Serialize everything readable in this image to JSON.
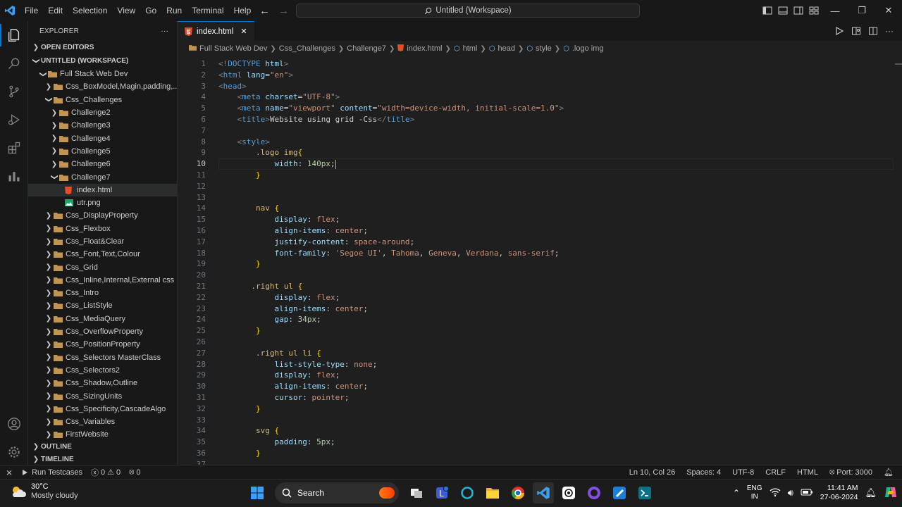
{
  "menu": [
    "File",
    "Edit",
    "Selection",
    "View",
    "Go",
    "Run",
    "Terminal",
    "Help"
  ],
  "command_center": "Untitled (Workspace)",
  "sidebar": {
    "title": "EXPLORER",
    "more": "···",
    "open_editors": "OPEN EDITORS",
    "workspace": "UNTITLED (WORKSPACE)",
    "root": "Full Stack Web Dev",
    "items": [
      {
        "label": "Css_BoxModel,Magin,padding,...",
        "depth": 1,
        "open": false,
        "type": "folder"
      },
      {
        "label": "Css_Challenges",
        "depth": 1,
        "open": true,
        "type": "folder"
      },
      {
        "label": "Challenge2",
        "depth": 2,
        "open": false,
        "type": "folder"
      },
      {
        "label": "Challenge3",
        "depth": 2,
        "open": false,
        "type": "folder"
      },
      {
        "label": "Challenge4",
        "depth": 2,
        "open": false,
        "type": "folder"
      },
      {
        "label": "Challenge5",
        "depth": 2,
        "open": false,
        "type": "folder"
      },
      {
        "label": "Challenge6",
        "depth": 2,
        "open": false,
        "type": "folder"
      },
      {
        "label": "Challenge7",
        "depth": 2,
        "open": true,
        "type": "folder"
      },
      {
        "label": "index.html",
        "depth": 3,
        "type": "html",
        "selected": true
      },
      {
        "label": "utr.png",
        "depth": 3,
        "type": "image"
      },
      {
        "label": "Css_DisplayProperty",
        "depth": 1,
        "open": false,
        "type": "folder"
      },
      {
        "label": "Css_Flexbox",
        "depth": 1,
        "open": false,
        "type": "folder"
      },
      {
        "label": "Css_Float&Clear",
        "depth": 1,
        "open": false,
        "type": "folder"
      },
      {
        "label": "Css_Font,Text,Colour",
        "depth": 1,
        "open": false,
        "type": "folder"
      },
      {
        "label": "Css_Grid",
        "depth": 1,
        "open": false,
        "type": "folder"
      },
      {
        "label": "Css_Inline,Internal,External css",
        "depth": 1,
        "open": false,
        "type": "folder"
      },
      {
        "label": "Css_Intro",
        "depth": 1,
        "open": false,
        "type": "folder"
      },
      {
        "label": "Css_ListStyle",
        "depth": 1,
        "open": false,
        "type": "folder"
      },
      {
        "label": "Css_MediaQuery",
        "depth": 1,
        "open": false,
        "type": "folder"
      },
      {
        "label": "Css_OverflowProperty",
        "depth": 1,
        "open": false,
        "type": "folder"
      },
      {
        "label": "Css_PositionProperty",
        "depth": 1,
        "open": false,
        "type": "folder"
      },
      {
        "label": "Css_Selectors MasterClass",
        "depth": 1,
        "open": false,
        "type": "folder"
      },
      {
        "label": "Css_Selectors2",
        "depth": 1,
        "open": false,
        "type": "folder"
      },
      {
        "label": "Css_Shadow,Outline",
        "depth": 1,
        "open": false,
        "type": "folder"
      },
      {
        "label": "Css_SizingUnits",
        "depth": 1,
        "open": false,
        "type": "folder"
      },
      {
        "label": "Css_Specificity,CascadeAlgo",
        "depth": 1,
        "open": false,
        "type": "folder"
      },
      {
        "label": "Css_Variables",
        "depth": 1,
        "open": false,
        "type": "folder"
      },
      {
        "label": "FirstWebsite",
        "depth": 1,
        "open": false,
        "type": "folder"
      }
    ],
    "outline": "OUTLINE",
    "timeline": "TIMELINE"
  },
  "tab": {
    "label": "index.html",
    "close": "✕"
  },
  "breadcrumb": [
    "Full Stack Web Dev",
    "Css_Challenges",
    "Challenge7",
    "index.html",
    "html",
    "head",
    "style",
    ".logo img"
  ],
  "editor": {
    "current_line": 10,
    "lines": [
      [
        [
          "t-br",
          "<!"
        ],
        [
          "t-doc",
          "DOCTYPE"
        ],
        [
          "t-txt",
          " "
        ],
        [
          "t-attr",
          "html"
        ],
        [
          "t-br",
          ">"
        ]
      ],
      [
        [
          "t-br",
          "<"
        ],
        [
          "t-tag",
          "html"
        ],
        [
          "t-txt",
          " "
        ],
        [
          "t-attr",
          "lang"
        ],
        [
          "t-txt",
          "="
        ],
        [
          "t-str",
          "\"en\""
        ],
        [
          "t-br",
          ">"
        ]
      ],
      [
        [
          "t-br",
          "<"
        ],
        [
          "t-tag",
          "head"
        ],
        [
          "t-br",
          ">"
        ]
      ],
      [
        [
          "t-txt",
          "    "
        ],
        [
          "t-br",
          "<"
        ],
        [
          "t-tag",
          "meta"
        ],
        [
          "t-txt",
          " "
        ],
        [
          "t-attr",
          "charset"
        ],
        [
          "t-txt",
          "="
        ],
        [
          "t-str",
          "\"UTF-8\""
        ],
        [
          "t-br",
          ">"
        ]
      ],
      [
        [
          "t-txt",
          "    "
        ],
        [
          "t-br",
          "<"
        ],
        [
          "t-tag",
          "meta"
        ],
        [
          "t-txt",
          " "
        ],
        [
          "t-attr",
          "name"
        ],
        [
          "t-txt",
          "="
        ],
        [
          "t-str",
          "\"viewport\""
        ],
        [
          "t-txt",
          " "
        ],
        [
          "t-attr",
          "content"
        ],
        [
          "t-txt",
          "="
        ],
        [
          "t-str",
          "\"width=device-width, initial-scale=1.0\""
        ],
        [
          "t-br",
          ">"
        ]
      ],
      [
        [
          "t-txt",
          "    "
        ],
        [
          "t-br",
          "<"
        ],
        [
          "t-tag",
          "title"
        ],
        [
          "t-br",
          ">"
        ],
        [
          "t-txt",
          "Website using grid -Css"
        ],
        [
          "t-br",
          "</"
        ],
        [
          "t-tag",
          "title"
        ],
        [
          "t-br",
          ">"
        ]
      ],
      [],
      [
        [
          "t-txt",
          "    "
        ],
        [
          "t-br",
          "<"
        ],
        [
          "t-tag",
          "style"
        ],
        [
          "t-br",
          ">"
        ]
      ],
      [
        [
          "t-txt",
          "        "
        ],
        [
          "t-sel",
          ".logo"
        ],
        [
          "t-txt",
          " "
        ],
        [
          "t-sel",
          "img"
        ],
        [
          "t-br1",
          "{"
        ]
      ],
      [
        [
          "t-txt",
          "            "
        ],
        [
          "t-prop",
          "width"
        ],
        [
          "t-txt",
          ": "
        ],
        [
          "t-num",
          "140px"
        ],
        [
          "t-txt",
          ";"
        ]
      ],
      [
        [
          "t-txt",
          "        "
        ],
        [
          "t-br1",
          "}"
        ]
      ],
      [],
      [],
      [
        [
          "t-txt",
          "        "
        ],
        [
          "t-sel",
          "nav"
        ],
        [
          "t-txt",
          " "
        ],
        [
          "t-br1",
          "{"
        ]
      ],
      [
        [
          "t-txt",
          "            "
        ],
        [
          "t-prop",
          "display"
        ],
        [
          "t-txt",
          ": "
        ],
        [
          "t-str",
          "flex"
        ],
        [
          "t-txt",
          ";"
        ]
      ],
      [
        [
          "t-txt",
          "            "
        ],
        [
          "t-prop",
          "align-items"
        ],
        [
          "t-txt",
          ": "
        ],
        [
          "t-str",
          "center"
        ],
        [
          "t-txt",
          ";"
        ]
      ],
      [
        [
          "t-txt",
          "            "
        ],
        [
          "t-prop",
          "justify-content"
        ],
        [
          "t-txt",
          ": "
        ],
        [
          "t-str",
          "space-around"
        ],
        [
          "t-txt",
          ";"
        ]
      ],
      [
        [
          "t-txt",
          "            "
        ],
        [
          "t-prop",
          "font-family"
        ],
        [
          "t-txt",
          ": "
        ],
        [
          "t-str",
          "'Segoe UI'"
        ],
        [
          "t-txt",
          ", "
        ],
        [
          "t-str",
          "Tahoma"
        ],
        [
          "t-txt",
          ", "
        ],
        [
          "t-str",
          "Geneva"
        ],
        [
          "t-txt",
          ", "
        ],
        [
          "t-str",
          "Verdana"
        ],
        [
          "t-txt",
          ", "
        ],
        [
          "t-str",
          "sans-serif"
        ],
        [
          "t-txt",
          ";"
        ]
      ],
      [
        [
          "t-txt",
          "        "
        ],
        [
          "t-br1",
          "}"
        ]
      ],
      [],
      [
        [
          "t-txt",
          "       "
        ],
        [
          "t-sel",
          ".right"
        ],
        [
          "t-txt",
          " "
        ],
        [
          "t-sel",
          "ul"
        ],
        [
          "t-txt",
          " "
        ],
        [
          "t-br1",
          "{"
        ]
      ],
      [
        [
          "t-txt",
          "            "
        ],
        [
          "t-prop",
          "display"
        ],
        [
          "t-txt",
          ": "
        ],
        [
          "t-str",
          "flex"
        ],
        [
          "t-txt",
          ";"
        ]
      ],
      [
        [
          "t-txt",
          "            "
        ],
        [
          "t-prop",
          "align-items"
        ],
        [
          "t-txt",
          ": "
        ],
        [
          "t-str",
          "center"
        ],
        [
          "t-txt",
          ";"
        ]
      ],
      [
        [
          "t-txt",
          "            "
        ],
        [
          "t-prop",
          "gap"
        ],
        [
          "t-txt",
          ": "
        ],
        [
          "t-num",
          "34px"
        ],
        [
          "t-txt",
          ";"
        ]
      ],
      [
        [
          "t-txt",
          "        "
        ],
        [
          "t-br1",
          "}"
        ]
      ],
      [],
      [
        [
          "t-txt",
          "        "
        ],
        [
          "t-sel",
          ".right"
        ],
        [
          "t-txt",
          " "
        ],
        [
          "t-sel",
          "ul"
        ],
        [
          "t-txt",
          " "
        ],
        [
          "t-sel",
          "li"
        ],
        [
          "t-txt",
          " "
        ],
        [
          "t-br1",
          "{"
        ]
      ],
      [
        [
          "t-txt",
          "            "
        ],
        [
          "t-prop",
          "list-style-type"
        ],
        [
          "t-txt",
          ": "
        ],
        [
          "t-str",
          "none"
        ],
        [
          "t-txt",
          ";"
        ]
      ],
      [
        [
          "t-txt",
          "            "
        ],
        [
          "t-prop",
          "display"
        ],
        [
          "t-txt",
          ": "
        ],
        [
          "t-str",
          "flex"
        ],
        [
          "t-txt",
          ";"
        ]
      ],
      [
        [
          "t-txt",
          "            "
        ],
        [
          "t-prop",
          "align-items"
        ],
        [
          "t-txt",
          ": "
        ],
        [
          "t-str",
          "center"
        ],
        [
          "t-txt",
          ";"
        ]
      ],
      [
        [
          "t-txt",
          "            "
        ],
        [
          "t-prop",
          "cursor"
        ],
        [
          "t-txt",
          ": "
        ],
        [
          "t-str",
          "pointer"
        ],
        [
          "t-txt",
          ";"
        ]
      ],
      [
        [
          "t-txt",
          "        "
        ],
        [
          "t-br1",
          "}"
        ]
      ],
      [],
      [
        [
          "t-txt",
          "        "
        ],
        [
          "t-sel",
          "svg"
        ],
        [
          "t-txt",
          " "
        ],
        [
          "t-br1",
          "{"
        ]
      ],
      [
        [
          "t-txt",
          "            "
        ],
        [
          "t-prop",
          "padding"
        ],
        [
          "t-txt",
          ": "
        ],
        [
          "t-num",
          "5px"
        ],
        [
          "t-txt",
          ";"
        ]
      ],
      [
        [
          "t-txt",
          "        "
        ],
        [
          "t-br1",
          "}"
        ]
      ],
      []
    ]
  },
  "statusbar": {
    "run_testcases": "Run Testcases",
    "errors": "0",
    "warnings": "0",
    "ports_count": "0",
    "position": "Ln 10, Col 26",
    "spaces": "Spaces: 4",
    "encoding": "UTF-8",
    "eol": "CRLF",
    "language": "HTML",
    "port": "Port: 3000"
  },
  "taskbar": {
    "temp": "30°C",
    "weather": "Mostly cloudy",
    "search": "Search",
    "lang1": "ENG",
    "lang2": "IN",
    "time": "11:41 AM",
    "date": "27-06-2024"
  },
  "colors": {
    "accent": "#0078d4",
    "html_icon": "#e44d26",
    "folder": "#c09553"
  }
}
